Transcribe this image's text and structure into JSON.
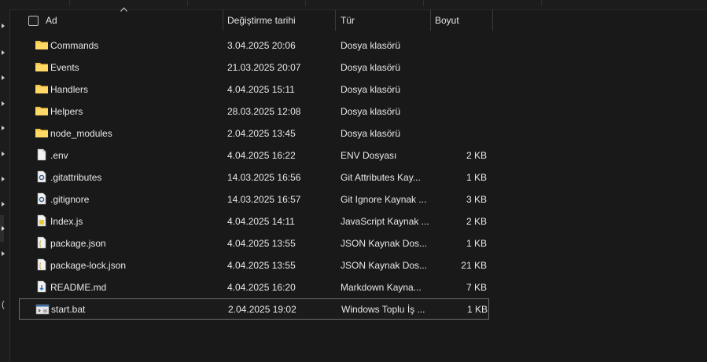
{
  "header": {
    "name_label": "Ad",
    "date_label": "Değiştirme tarihi",
    "type_label": "Tür",
    "size_label": "Boyut"
  },
  "left_pane": {
    "paren": "("
  },
  "files": [
    {
      "name": "Commands",
      "date": "3.04.2025 20:06",
      "type": "Dosya klasörü",
      "size": "",
      "icon": "folder-icon"
    },
    {
      "name": "Events",
      "date": "21.03.2025 20:07",
      "type": "Dosya klasörü",
      "size": "",
      "icon": "folder-icon"
    },
    {
      "name": "Handlers",
      "date": "4.04.2025 15:11",
      "type": "Dosya klasörü",
      "size": "",
      "icon": "folder-icon"
    },
    {
      "name": "Helpers",
      "date": "28.03.2025 12:08",
      "type": "Dosya klasörü",
      "size": "",
      "icon": "folder-icon"
    },
    {
      "name": "node_modules",
      "date": "2.04.2025 13:45",
      "type": "Dosya klasörü",
      "size": "",
      "icon": "folder-icon"
    },
    {
      "name": ".env",
      "date": "4.04.2025 16:22",
      "type": "ENV Dosyası",
      "size": "2 KB",
      "icon": "blank-file-icon"
    },
    {
      "name": ".gitattributes",
      "date": "14.03.2025 16:56",
      "type": "Git Attributes Kay...",
      "size": "1 KB",
      "icon": "config-file-icon"
    },
    {
      "name": ".gitignore",
      "date": "14.03.2025 16:57",
      "type": "Git Ignore Kaynak ...",
      "size": "3 KB",
      "icon": "config-file-icon"
    },
    {
      "name": "Index.js",
      "date": "4.04.2025 14:11",
      "type": "JavaScript Kaynak ...",
      "size": "2 KB",
      "icon": "js-file-icon"
    },
    {
      "name": "package.json",
      "date": "4.04.2025 13:55",
      "type": "JSON Kaynak Dos...",
      "size": "1 KB",
      "icon": "json-file-icon"
    },
    {
      "name": "package-lock.json",
      "date": "4.04.2025 13:55",
      "type": "JSON Kaynak Dos...",
      "size": "21 KB",
      "icon": "json-file-icon"
    },
    {
      "name": "README.md",
      "date": "4.04.2025 16:20",
      "type": "Markdown Kayna...",
      "size": "7 KB",
      "icon": "markdown-file-icon"
    },
    {
      "name": "start.bat",
      "date": "2.04.2025 19:02",
      "type": "Windows Toplu İş ...",
      "size": "1 KB",
      "icon": "batch-file-icon"
    }
  ],
  "selected_index": 12,
  "colors": {
    "background": "#191919",
    "folder": "#f4c542",
    "text": "#e6e6e6",
    "selection_border": "#6e6e6e"
  }
}
